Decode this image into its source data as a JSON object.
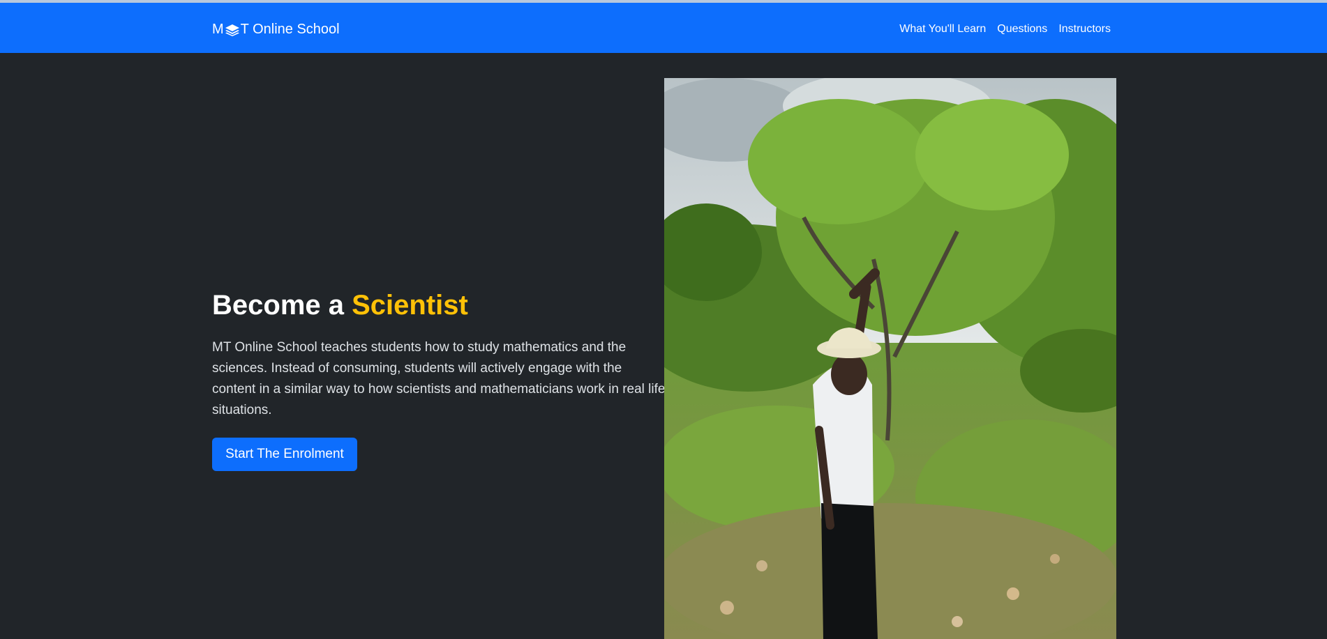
{
  "navbar": {
    "brand_prefix": "M",
    "brand_suffix": "T Online School",
    "brand_icon": "layers-icon",
    "links": [
      {
        "label": "What You'll Learn"
      },
      {
        "label": "Questions"
      },
      {
        "label": "Instructors"
      }
    ]
  },
  "hero": {
    "title_plain": "Become a ",
    "title_accent": "Scientist",
    "description": "MT Online School teaches students how to study mathematics and the sciences. Instead of consuming, students will actively engage with the content in a similar way to how scientists and mathematicians work in real life situations.",
    "cta_label": "Start The Enrolment",
    "image_subject": "man-reaching-tree-branch"
  },
  "colors": {
    "primary": "#0d6efd",
    "background": "#212529",
    "accent": "#ffc107",
    "text": "#ffffff"
  }
}
